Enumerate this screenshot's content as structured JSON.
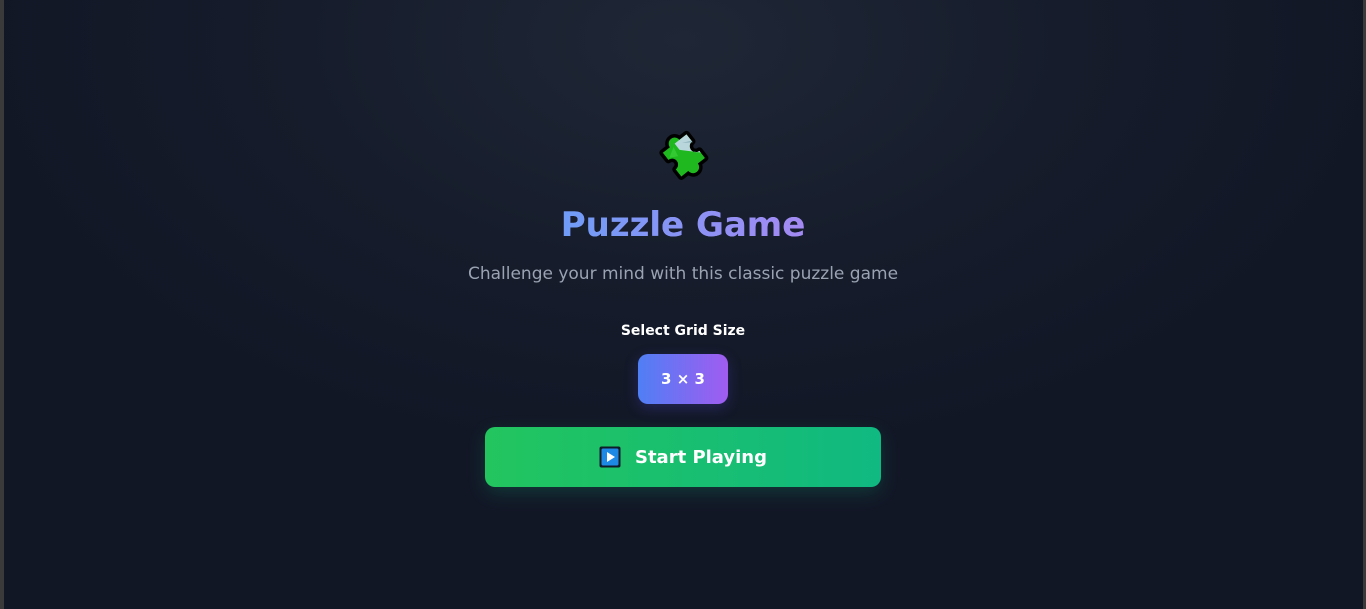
{
  "app": {
    "logo_icon": "puzzle-piece-icon",
    "title": "Puzzle Game",
    "subtitle": "Challenge your mind with this classic puzzle game"
  },
  "grid_size": {
    "label": "Select Grid Size",
    "selected": "3 × 3"
  },
  "actions": {
    "start_icon": "play-button-icon",
    "start_label": "Start Playing"
  },
  "colors": {
    "background": "#161c2b",
    "title_gradient_start": "#6f9cf7",
    "title_gradient_end": "#a98af3",
    "subtitle": "#9aa3b2",
    "grid_button_start": "#4f7ff5",
    "grid_button_end": "#a05cf0",
    "start_button_start": "#22c55e",
    "start_button_end": "#10b981"
  }
}
